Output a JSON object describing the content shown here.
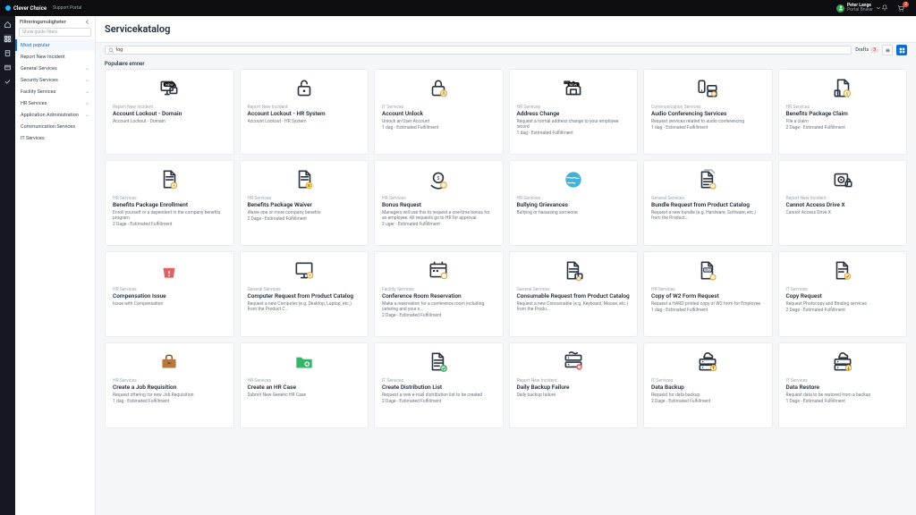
{
  "brand": {
    "name": "Clever Choice",
    "portal": "Support Portal"
  },
  "user": {
    "name": "Peter Lange",
    "role": "Portal Bruker",
    "initial": "P"
  },
  "topbar_badges": {
    "cart": "2"
  },
  "sidebar": {
    "header": "Filtreringsmuligheter",
    "filter_placeholder": "Show guide filters",
    "items": [
      {
        "label": "Most popular",
        "expandable": false
      },
      {
        "label": "Report New Incident",
        "expandable": false
      },
      {
        "label": "General Services",
        "expandable": true
      },
      {
        "label": "Security Services",
        "expandable": true
      },
      {
        "label": "Facility Services",
        "expandable": true
      },
      {
        "label": "HR Services",
        "expandable": true
      },
      {
        "label": "Application Administration",
        "expandable": true
      },
      {
        "label": "Communication Services",
        "expandable": false
      },
      {
        "label": "IT Services",
        "expandable": false
      }
    ]
  },
  "page_title": "Servicekatalog",
  "search_text": "log",
  "drafts": {
    "label": "Drafts",
    "count": "3"
  },
  "section_label": "Populære emner",
  "cards": [
    {
      "icon": "padlock-monitor",
      "pill": "NEW",
      "category": "Report New Incident",
      "title": "Account Lockout - Domain",
      "desc": "Account Lockout - Domain",
      "sla": ""
    },
    {
      "icon": "padlock-open",
      "category": "Report New Incident",
      "title": "Account Lockout - HR System",
      "desc": "Account Lockout - HR System",
      "sla": ""
    },
    {
      "icon": "padlock-user",
      "category": "IT Services",
      "title": "Account Unlock",
      "desc": "Unlock an User Account",
      "sla": "1 dag - Estimated Fulfillment"
    },
    {
      "icon": "house-tag",
      "pill": "NEW",
      "category": "HR Services",
      "title": "Address Change",
      "desc": "Request a formal address change to your employee record",
      "sla": "1 dag - Estimated Fulfillment"
    },
    {
      "icon": "phone-server",
      "category": "Communication Services",
      "title": "Audio Conferencing Services",
      "desc": "Request services related to audio conferencing",
      "sla": "1 dag - Estimated Fulfillment"
    },
    {
      "icon": "doc-dollar",
      "category": "HR Services",
      "title": "Benefits Package Claim",
      "desc": "File a claim",
      "sla": "2 Dage - Estimated Fulfillment"
    },
    {
      "icon": "doc-cog",
      "category": "HR Services",
      "title": "Benefits Package Enrollment",
      "desc": "Enroll yourself or a dependent in the company benefits program",
      "sla": "2 Dage - Estimated Fulfillment"
    },
    {
      "icon": "doc-x",
      "category": "HR Services",
      "title": "Benefits Package Waiver",
      "desc": "Waive one or more company benefits",
      "sla": "2 Dage - Estimated Fulfillment"
    },
    {
      "icon": "coin-arrows",
      "category": "HR Services",
      "title": "Bonus Request",
      "desc": "Managers will use this to request a one-time bonus for an employee. All requests go to HR for approval.",
      "sla": "2 uger - Estimated Fulfillment"
    },
    {
      "icon": "globe",
      "category": "HR Services",
      "title": "Bullying Grievances",
      "desc": "Bullying or harassing someone",
      "sla": ""
    },
    {
      "icon": "doc-stack",
      "category": "General Services",
      "title": "Bundle Request from Product Catalog",
      "desc": "Request a new bundle (e.g. Hardware, Software, etc.) from the Product…",
      "sla": ""
    },
    {
      "icon": "drive-lock",
      "category": "Report New Incident",
      "title": "Cannot Access Drive X",
      "desc": "Cannot Access Drive X",
      "sla": ""
    },
    {
      "icon": "bag-alert",
      "category": "HR Services",
      "title": "Compensation Issue",
      "desc": "Issue with Compensation",
      "sla": ""
    },
    {
      "icon": "monitor-cog",
      "category": "General Services",
      "title": "Computer Request from Product Catalog",
      "desc": "Request a new Computer (e.g. Desktop, Laptop, etc.) from the Product C…",
      "sla": ""
    },
    {
      "icon": "schedule",
      "category": "Facility Services",
      "title": "Conference Room Reservation",
      "desc": "Make a reservation for a conference room including catering and your n…",
      "sla": "2 Dage - Estimated Fulfillment"
    },
    {
      "icon": "doc-box",
      "category": "General Services",
      "title": "Consumable Request from Product Catalog",
      "desc": "Request a new Consumable (e.g. Keyboard, Mouse, etc.) from the Produ…",
      "sla": ""
    },
    {
      "icon": "doc-w2",
      "category": "HR Services",
      "title": "Copy of W2 Form Request",
      "desc": "Request a HARD printed copy of W2 form for Employee",
      "sla": "1 dag - Estimated Fulfillment"
    },
    {
      "icon": "doc-stamp",
      "category": "IT Services",
      "title": "Copy Request",
      "desc": "Request Photocopy and Binding services",
      "sla": "2 Dage - Estimated Fulfillment"
    },
    {
      "icon": "briefcase",
      "category": "HR Services",
      "title": "Create a Job Requisition",
      "desc": "Request offering for new Job Requisition",
      "sla": "1 dag - Estimated Fulfillment"
    },
    {
      "icon": "folder-plus",
      "category": "HR Services",
      "title": "Create an HR Case",
      "desc": "Submit New Generic HR Case",
      "sla": ""
    },
    {
      "icon": "doc-check",
      "category": "IT Services",
      "title": "Create Distribution List",
      "desc": "Request a new e-mail distribution list to be created",
      "sla": "2 Dage - Estimated Fulfillment"
    },
    {
      "icon": "server-x",
      "category": "Report New Incident",
      "title": "Daily Backup Failure",
      "desc": "Daily backup failure",
      "sla": ""
    },
    {
      "icon": "server-cloud-up",
      "category": "IT Services",
      "title": "Data Backup",
      "desc": "Request for data backup",
      "sla": "2 Dage - Estimated Fulfillment"
    },
    {
      "icon": "server-cloud-down",
      "category": "IT Services",
      "title": "Data Restore",
      "desc": "Request data to be restored from a backup",
      "sla": "1 Dage - Estimated Fulfillment"
    }
  ]
}
